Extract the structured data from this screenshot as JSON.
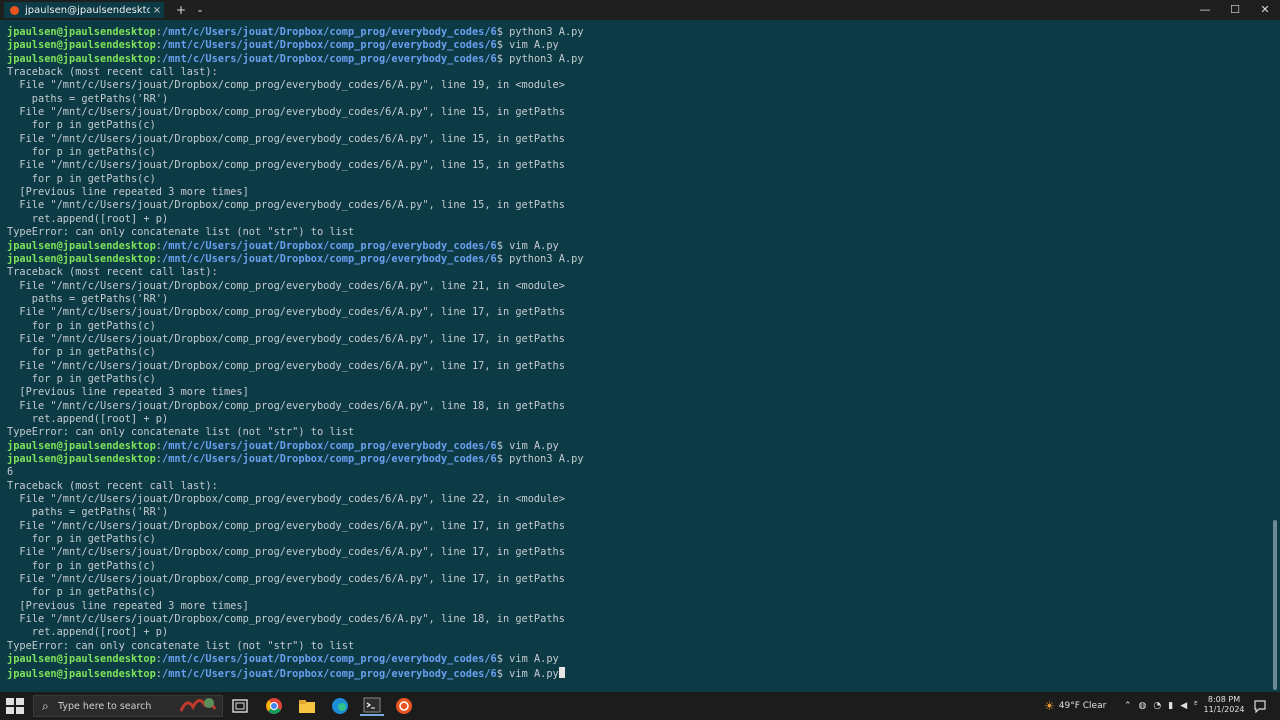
{
  "window": {
    "tab_title": "jpaulsen@jpaulsendesktop: /r",
    "tab_close": "×",
    "new_tab": "+",
    "tab_menu": "⌄",
    "minimize": "—",
    "maximize": "☐",
    "close": "✕"
  },
  "terminal": {
    "lines": [
      {
        "type": "prompt",
        "user": "jpaulsen@jpaulsendesktop",
        "path": "/mnt/c/Users/jouat/Dropbox/comp_prog/everybody_codes/6",
        "cmd": "$ python3 A.py"
      },
      {
        "type": "prompt",
        "user": "jpaulsen@jpaulsendesktop",
        "path": "/mnt/c/Users/jouat/Dropbox/comp_prog/everybody_codes/6",
        "cmd": "$ vim A.py"
      },
      {
        "type": "prompt",
        "user": "jpaulsen@jpaulsendesktop",
        "path": "/mnt/c/Users/jouat/Dropbox/comp_prog/everybody_codes/6",
        "cmd": "$ python3 A.py"
      },
      {
        "type": "text",
        "text": "Traceback (most recent call last):"
      },
      {
        "type": "text",
        "text": "  File \"/mnt/c/Users/jouat/Dropbox/comp_prog/everybody_codes/6/A.py\", line 19, in <module>"
      },
      {
        "type": "text",
        "text": "    paths = getPaths('RR')"
      },
      {
        "type": "text",
        "text": "  File \"/mnt/c/Users/jouat/Dropbox/comp_prog/everybody_codes/6/A.py\", line 15, in getPaths"
      },
      {
        "type": "text",
        "text": "    for p in getPaths(c)"
      },
      {
        "type": "text",
        "text": "  File \"/mnt/c/Users/jouat/Dropbox/comp_prog/everybody_codes/6/A.py\", line 15, in getPaths"
      },
      {
        "type": "text",
        "text": "    for p in getPaths(c)"
      },
      {
        "type": "text",
        "text": "  File \"/mnt/c/Users/jouat/Dropbox/comp_prog/everybody_codes/6/A.py\", line 15, in getPaths"
      },
      {
        "type": "text",
        "text": "    for p in getPaths(c)"
      },
      {
        "type": "text",
        "text": "  [Previous line repeated 3 more times]"
      },
      {
        "type": "text",
        "text": "  File \"/mnt/c/Users/jouat/Dropbox/comp_prog/everybody_codes/6/A.py\", line 15, in getPaths"
      },
      {
        "type": "text",
        "text": "    ret.append([root] + p)"
      },
      {
        "type": "text",
        "text": "TypeError: can only concatenate list (not \"str\") to list"
      },
      {
        "type": "prompt",
        "user": "jpaulsen@jpaulsendesktop",
        "path": "/mnt/c/Users/jouat/Dropbox/comp_prog/everybody_codes/6",
        "cmd": "$ vim A.py"
      },
      {
        "type": "prompt",
        "user": "jpaulsen@jpaulsendesktop",
        "path": "/mnt/c/Users/jouat/Dropbox/comp_prog/everybody_codes/6",
        "cmd": "$ python3 A.py"
      },
      {
        "type": "text",
        "text": "Traceback (most recent call last):"
      },
      {
        "type": "text",
        "text": "  File \"/mnt/c/Users/jouat/Dropbox/comp_prog/everybody_codes/6/A.py\", line 21, in <module>"
      },
      {
        "type": "text",
        "text": "    paths = getPaths('RR')"
      },
      {
        "type": "text",
        "text": "  File \"/mnt/c/Users/jouat/Dropbox/comp_prog/everybody_codes/6/A.py\", line 17, in getPaths"
      },
      {
        "type": "text",
        "text": "    for p in getPaths(c)"
      },
      {
        "type": "text",
        "text": "  File \"/mnt/c/Users/jouat/Dropbox/comp_prog/everybody_codes/6/A.py\", line 17, in getPaths"
      },
      {
        "type": "text",
        "text": "    for p in getPaths(c)"
      },
      {
        "type": "text",
        "text": "  File \"/mnt/c/Users/jouat/Dropbox/comp_prog/everybody_codes/6/A.py\", line 17, in getPaths"
      },
      {
        "type": "text",
        "text": "    for p in getPaths(c)"
      },
      {
        "type": "text",
        "text": "  [Previous line repeated 3 more times]"
      },
      {
        "type": "text",
        "text": "  File \"/mnt/c/Users/jouat/Dropbox/comp_prog/everybody_codes/6/A.py\", line 18, in getPaths"
      },
      {
        "type": "text",
        "text": "    ret.append([root] + p)"
      },
      {
        "type": "text",
        "text": "TypeError: can only concatenate list (not \"str\") to list"
      },
      {
        "type": "prompt",
        "user": "jpaulsen@jpaulsendesktop",
        "path": "/mnt/c/Users/jouat/Dropbox/comp_prog/everybody_codes/6",
        "cmd": "$ vim A.py"
      },
      {
        "type": "prompt",
        "user": "jpaulsen@jpaulsendesktop",
        "path": "/mnt/c/Users/jouat/Dropbox/comp_prog/everybody_codes/6",
        "cmd": "$ python3 A.py"
      },
      {
        "type": "text",
        "text": "6"
      },
      {
        "type": "text",
        "text": "Traceback (most recent call last):"
      },
      {
        "type": "text",
        "text": "  File \"/mnt/c/Users/jouat/Dropbox/comp_prog/everybody_codes/6/A.py\", line 22, in <module>"
      },
      {
        "type": "text",
        "text": "    paths = getPaths('RR')"
      },
      {
        "type": "text",
        "text": "  File \"/mnt/c/Users/jouat/Dropbox/comp_prog/everybody_codes/6/A.py\", line 17, in getPaths"
      },
      {
        "type": "text",
        "text": "    for p in getPaths(c)"
      },
      {
        "type": "text",
        "text": "  File \"/mnt/c/Users/jouat/Dropbox/comp_prog/everybody_codes/6/A.py\", line 17, in getPaths"
      },
      {
        "type": "text",
        "text": "    for p in getPaths(c)"
      },
      {
        "type": "text",
        "text": "  File \"/mnt/c/Users/jouat/Dropbox/comp_prog/everybody_codes/6/A.py\", line 17, in getPaths"
      },
      {
        "type": "text",
        "text": "    for p in getPaths(c)"
      },
      {
        "type": "text",
        "text": "  [Previous line repeated 3 more times]"
      },
      {
        "type": "text",
        "text": "  File \"/mnt/c/Users/jouat/Dropbox/comp_prog/everybody_codes/6/A.py\", line 18, in getPaths"
      },
      {
        "type": "text",
        "text": "    ret.append([root] + p)"
      },
      {
        "type": "text",
        "text": "TypeError: can only concatenate list (not \"str\") to list"
      },
      {
        "type": "prompt",
        "user": "jpaulsen@jpaulsendesktop",
        "path": "/mnt/c/Users/jouat/Dropbox/comp_prog/everybody_codes/6",
        "cmd": "$ vim A.py"
      },
      {
        "type": "prompt",
        "user": "jpaulsen@jpaulsendesktop",
        "path": "/mnt/c/Users/jouat/Dropbox/comp_prog/everybody_codes/6",
        "cmd": "$ vim A.py",
        "cursor": true
      }
    ]
  },
  "taskbar": {
    "search_placeholder": "Type here to search",
    "weather": "49°F  Clear",
    "time": "8:08 PM",
    "date": "11/1/2024",
    "icons": [
      "windows-start-icon",
      "search-icon",
      "widget-icon",
      "task-view-icon",
      "chrome-icon",
      "file-explorer-icon",
      "edge-icon",
      "terminal-icon",
      "ubuntu-icon"
    ]
  },
  "colors": {
    "background": "#0c3a45",
    "prompt_user": "#7ee35a",
    "prompt_path": "#6aa0f0",
    "text": "#c3cbd0"
  }
}
